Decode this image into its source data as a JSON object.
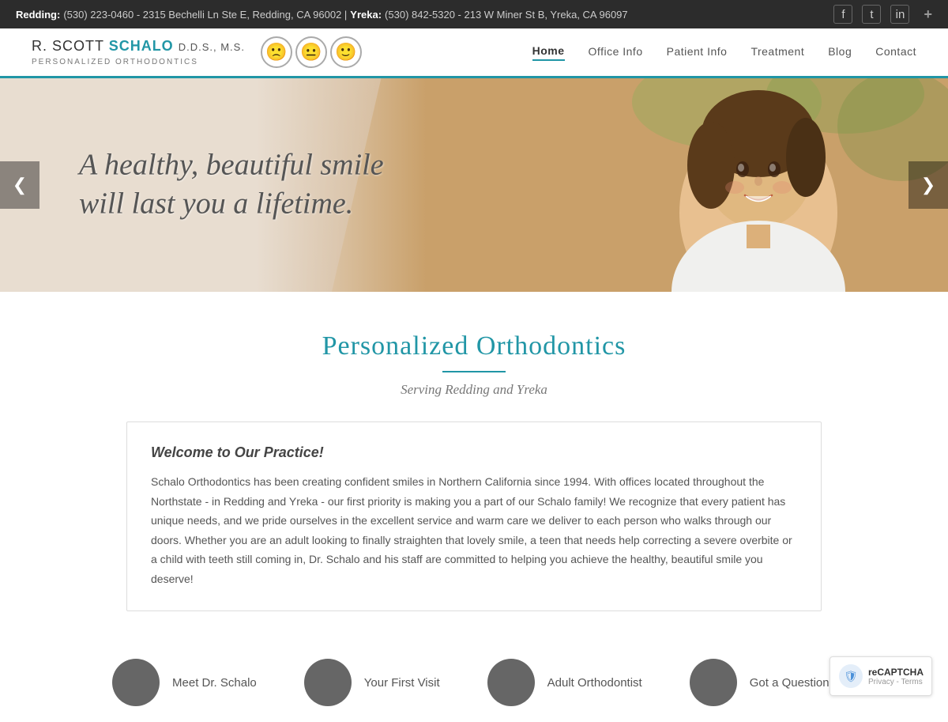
{
  "topbar": {
    "redding_label": "Redding:",
    "redding_info": "(530) 223-0460 - 2315 Bechelli Ln Ste E, Redding, CA 96002 |",
    "yreka_label": "Yreka:",
    "yreka_info": "(530) 842-5320 - 213 W Miner St B, Yreka, CA 96097",
    "plus_btn": "+"
  },
  "social": {
    "facebook": "f",
    "twitter": "t",
    "linkedin": "in"
  },
  "header": {
    "logo_first": "R. SCOTT",
    "logo_last": "SCHALO",
    "logo_credentials": "D.D.S., M.S.",
    "logo_tagline": "PERSONALIZED ORTHODONTICS"
  },
  "nav": {
    "items": [
      {
        "label": "Home",
        "active": true
      },
      {
        "label": "Office Info",
        "active": false
      },
      {
        "label": "Patient Info",
        "active": false
      },
      {
        "label": "Treatment",
        "active": false
      },
      {
        "label": "Blog",
        "active": false
      },
      {
        "label": "Contact",
        "active": false
      }
    ]
  },
  "hero": {
    "line1": "A healthy, beautiful smile",
    "line2": "will last you a lifetime.",
    "prev_btn": "❮",
    "next_btn": "❯"
  },
  "section": {
    "title": "Personalized Orthodontics",
    "subtitle": "Serving Redding and Yreka"
  },
  "welcome": {
    "title": "Welcome to Our Practice!",
    "text": "Schalo Orthodontics has been creating confident smiles in Northern California since 1994. With offices located throughout the Northstate - in Redding and Yreka - our first priority is making you a part of our Schalo family! We recognize that every patient has unique needs, and we pride ourselves in the excellent service and warm care we deliver to each person who walks through our doors. Whether you are an adult looking to finally straighten that lovely smile, a teen that needs help correcting a severe overbite or a child with teeth still coming in, Dr. Schalo and his staff are committed to helping you achieve the healthy, beautiful smile you deserve!"
  },
  "bottom_icons": [
    {
      "label": "Meet Dr. Schalo"
    },
    {
      "label": "Your First Visit"
    },
    {
      "label": "Adult Orthodontist"
    },
    {
      "label": "Got a Question?"
    }
  ],
  "recaptcha": {
    "text": "reCAPTCHA"
  }
}
